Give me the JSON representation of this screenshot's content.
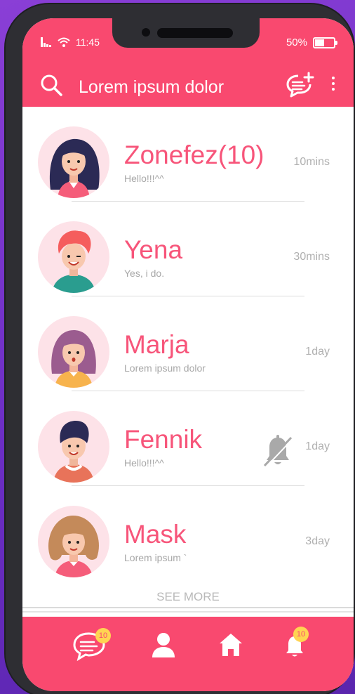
{
  "status_bar": {
    "time": "11:45",
    "battery": "50%",
    "battery_level": 0.5
  },
  "header": {
    "search_placeholder": "Lorem ipsum dolor"
  },
  "conversations": [
    {
      "name": "Zonefez(10)",
      "message": "Hello!!!^^",
      "time": "10mins",
      "muted": false
    },
    {
      "name": "Yena",
      "message": "Yes, i do.",
      "time": "30mins",
      "muted": false
    },
    {
      "name": "Marja",
      "message": "Lorem ipsum dolor",
      "time": "1day",
      "muted": false
    },
    {
      "name": "Fennik",
      "message": "Hello!!!^^",
      "time": "1day",
      "muted": true
    },
    {
      "name": "Mask",
      "message": "Lorem ipsum `",
      "time": "3day",
      "muted": false
    }
  ],
  "see_more": "SEE MORE",
  "bottom_nav": {
    "messages_badge": "10",
    "notifications_badge": "10"
  },
  "colors": {
    "accent": "#f9496f",
    "badge": "#ffd452",
    "background": "#6b2ec4"
  }
}
